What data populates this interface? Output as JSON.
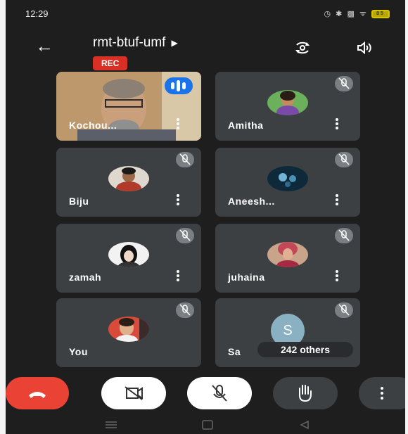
{
  "status_bar": {
    "time": "12:29",
    "icons_text": "◷ ✱ ▩ ᯤ",
    "battery": "85"
  },
  "header": {
    "meeting_code": "rmt-btuf-umf",
    "rec_badge": "REC"
  },
  "participants": [
    {
      "name": "Kochou...",
      "muted": false,
      "speaking": true
    },
    {
      "name": "Amitha",
      "muted": true
    },
    {
      "name": "Biju",
      "muted": true
    },
    {
      "name": "Aneesh...",
      "muted": true
    },
    {
      "name": "zamah",
      "muted": true
    },
    {
      "name": "juhaina",
      "muted": true
    },
    {
      "name": "You",
      "muted": true
    },
    {
      "name": "Sa",
      "muted": true,
      "avatar_letter": "S",
      "others_label": "242 others"
    }
  ],
  "colors": {
    "background": "#1e1e1f",
    "tile": "#3c4043",
    "rec": "#d93025",
    "end_call": "#ea4335",
    "speaking_badge": "#1a73e8"
  },
  "icons": {
    "back": "arrow-left-icon",
    "rotate_camera": "camera-switch-icon",
    "speaker": "speaker-icon",
    "end_call": "phone-hangup-icon",
    "camera_off": "video-off-icon",
    "mic_off": "mic-off-icon",
    "raise_hand": "hand-icon",
    "more": "more-vert-icon"
  }
}
